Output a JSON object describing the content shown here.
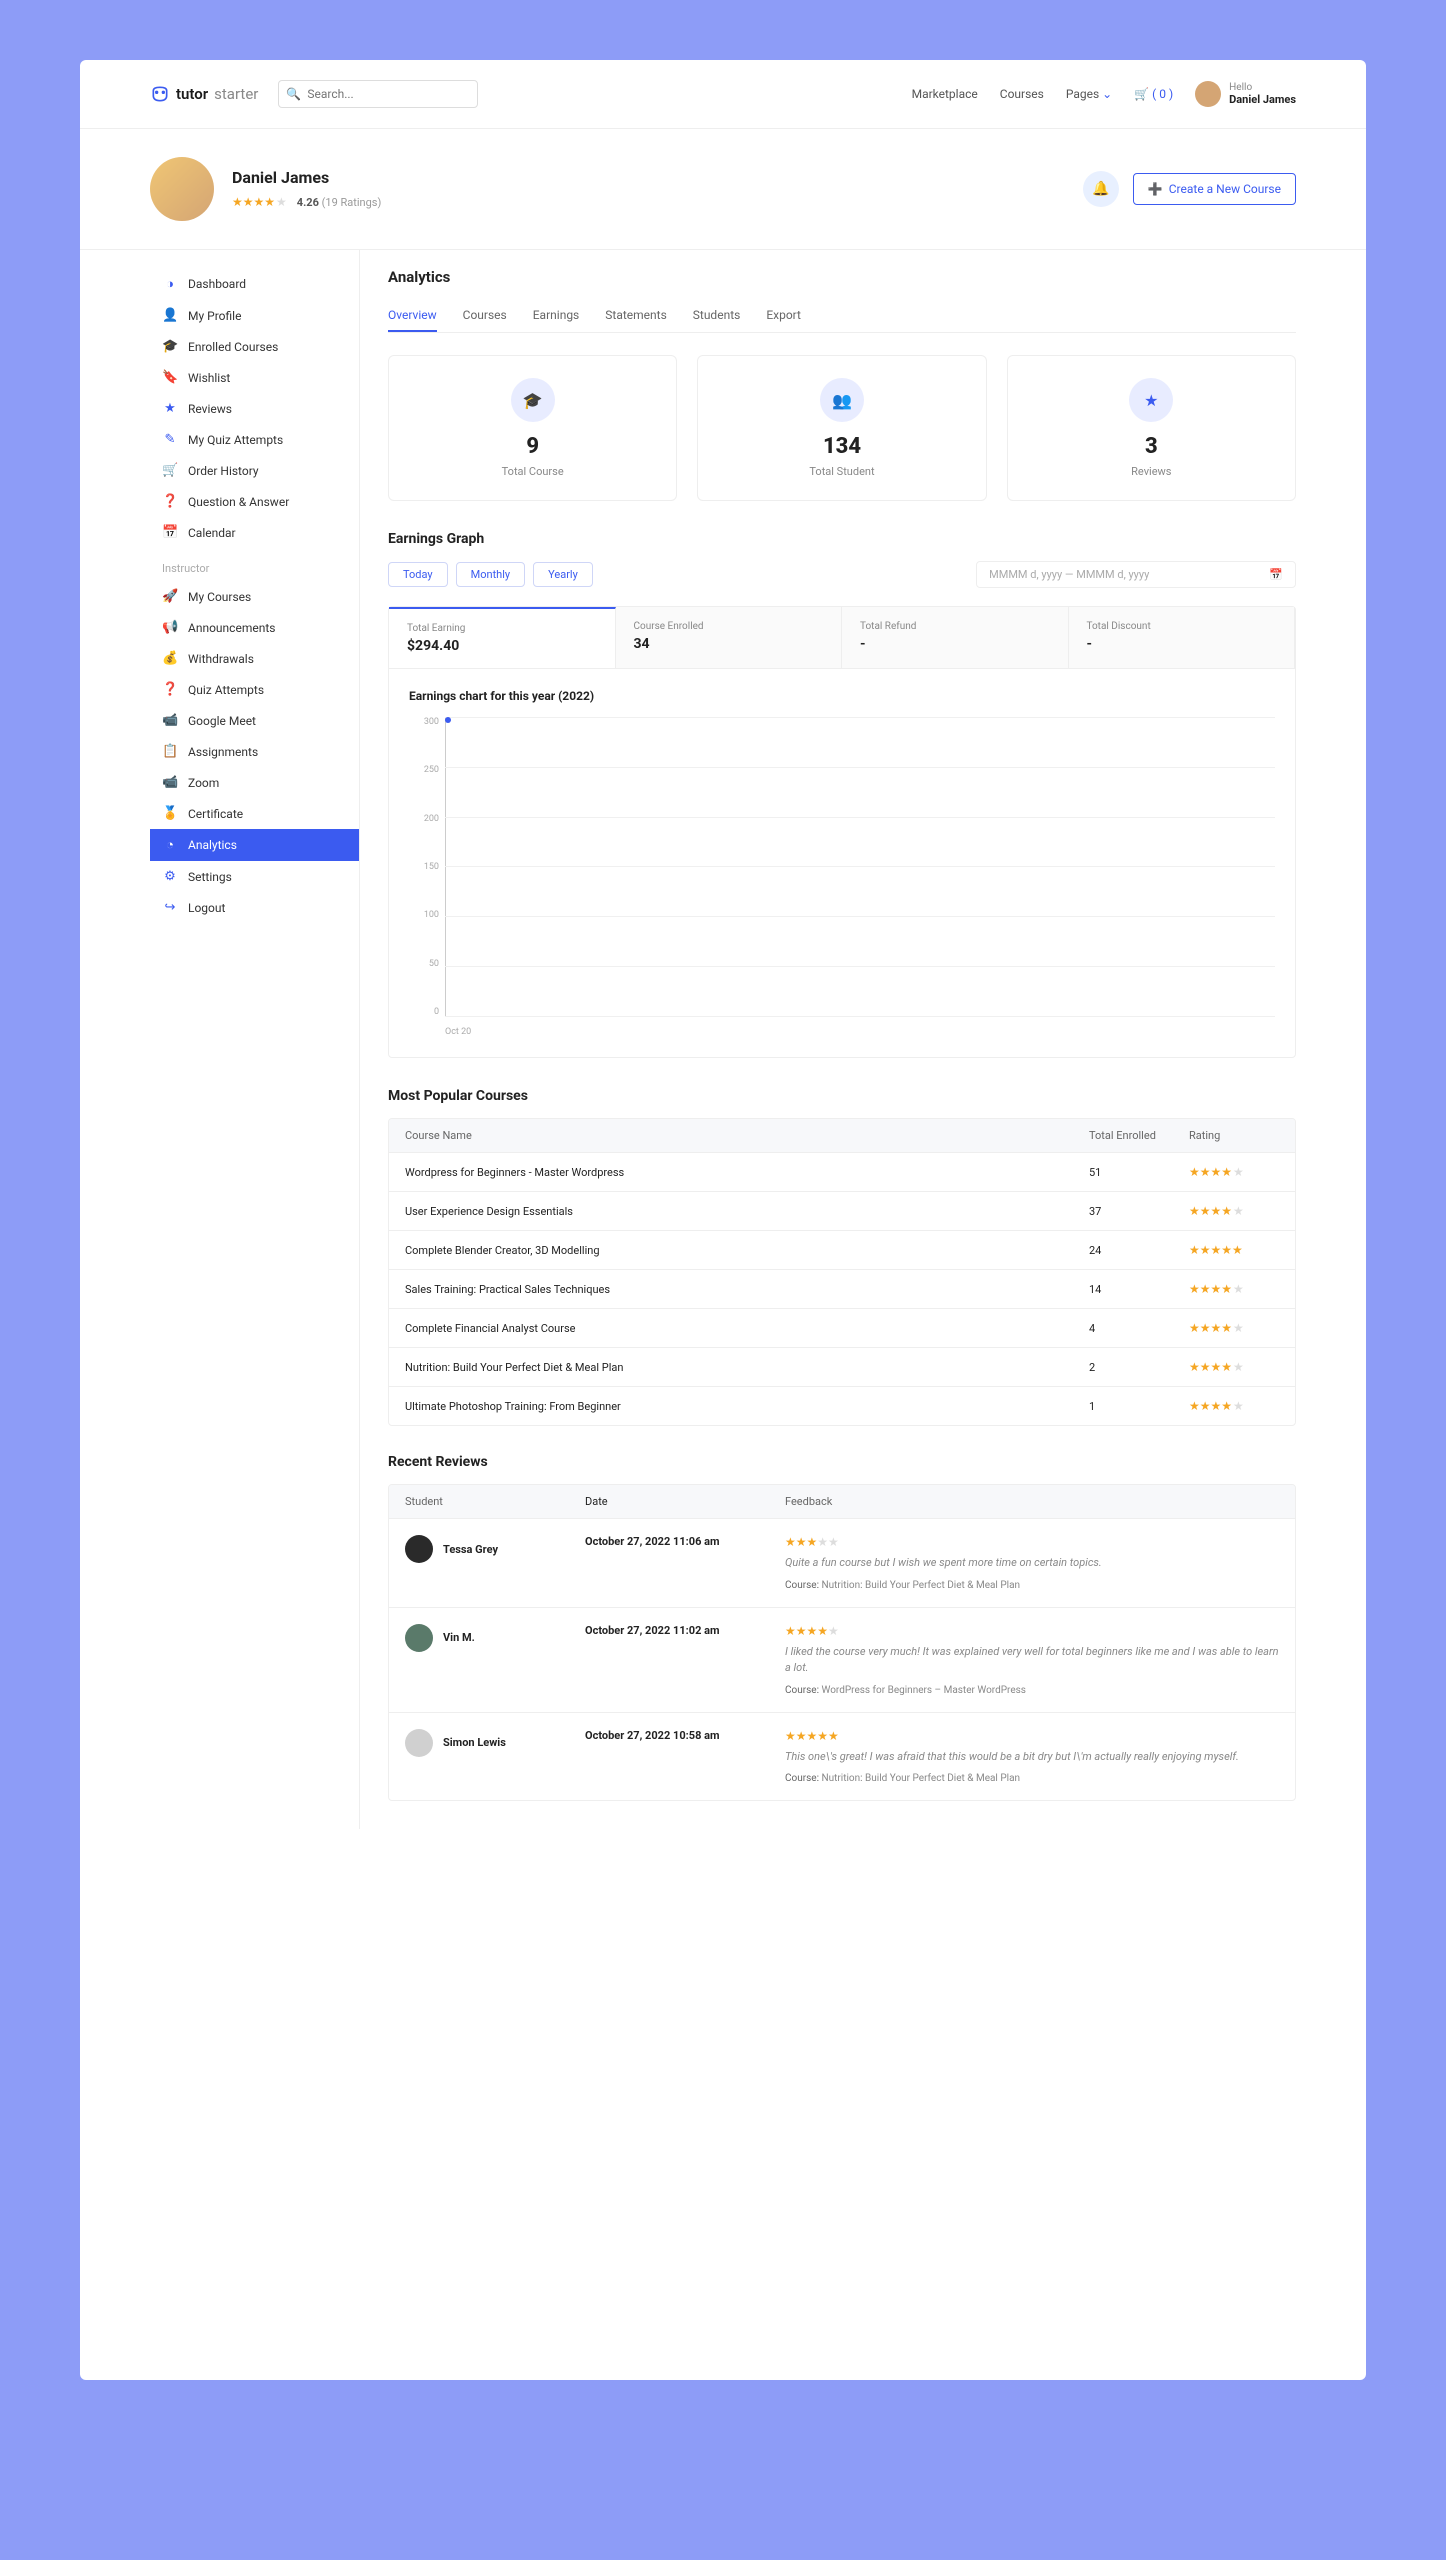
{
  "header": {
    "logo_a": "tutor",
    "logo_b": "starter",
    "search_placeholder": "Search...",
    "nav": {
      "marketplace": "Marketplace",
      "courses": "Courses",
      "pages": "Pages",
      "cart": "( 0 )",
      "hello": "Hello",
      "user": "Daniel James"
    }
  },
  "profile": {
    "name": "Daniel James",
    "rating": "4.26",
    "rating_count": "(19 Ratings)",
    "create_btn": "Create a New Course"
  },
  "sidebar": {
    "main": [
      {
        "icon": "◑",
        "label": "Dashboard"
      },
      {
        "icon": "👤",
        "label": "My Profile"
      },
      {
        "icon": "🎓",
        "label": "Enrolled Courses"
      },
      {
        "icon": "🔖",
        "label": "Wishlist"
      },
      {
        "icon": "★",
        "label": "Reviews"
      },
      {
        "icon": "✎",
        "label": "My Quiz Attempts"
      },
      {
        "icon": "🛒",
        "label": "Order History"
      },
      {
        "icon": "❓",
        "label": "Question & Answer"
      },
      {
        "icon": "📅",
        "label": "Calendar"
      }
    ],
    "sep": "Instructor",
    "instructor": [
      {
        "icon": "🚀",
        "label": "My Courses"
      },
      {
        "icon": "📢",
        "label": "Announcements"
      },
      {
        "icon": "💰",
        "label": "Withdrawals"
      },
      {
        "icon": "❓",
        "label": "Quiz Attempts"
      },
      {
        "icon": "📹",
        "label": "Google Meet"
      },
      {
        "icon": "📋",
        "label": "Assignments"
      },
      {
        "icon": "📹",
        "label": "Zoom"
      },
      {
        "icon": "🏅",
        "label": "Certificate"
      },
      {
        "icon": "◔",
        "label": "Analytics",
        "active": true
      }
    ],
    "bottom": [
      {
        "icon": "⚙",
        "label": "Settings"
      },
      {
        "icon": "↪",
        "label": "Logout"
      }
    ]
  },
  "page": {
    "title": "Analytics"
  },
  "tabs": [
    "Overview",
    "Courses",
    "Earnings",
    "Statements",
    "Students",
    "Export"
  ],
  "cards": [
    {
      "icon": "🎓",
      "value": "9",
      "label": "Total Course"
    },
    {
      "icon": "👥",
      "value": "134",
      "label": "Total Student"
    },
    {
      "icon": "★",
      "value": "3",
      "label": "Reviews"
    }
  ],
  "earnings": {
    "title": "Earnings Graph",
    "ranges": [
      "Today",
      "Monthly",
      "Yearly"
    ],
    "date_placeholder": "MMMM d, yyyy — MMMM d, yyyy",
    "gtabs": [
      {
        "label": "Total Earning",
        "value": "$294.40"
      },
      {
        "label": "Course Enrolled",
        "value": "34"
      },
      {
        "label": "Total Refund",
        "value": "-"
      },
      {
        "label": "Total Discount",
        "value": "-"
      }
    ],
    "chart_title": "Earnings chart for this year (2022)"
  },
  "chart_data": {
    "type": "line",
    "title": "Earnings chart for this year (2022)",
    "xlabel": "",
    "ylabel": "",
    "x": [
      "Oct 20"
    ],
    "values": [
      294.4
    ],
    "ylim": [
      0,
      300
    ],
    "yticks": [
      0,
      50,
      100,
      150,
      200,
      250,
      300
    ]
  },
  "popular": {
    "title": "Most Popular Courses",
    "headers": {
      "name": "Course Name",
      "enrolled": "Total Enrolled",
      "rating": "Rating"
    },
    "rows": [
      {
        "name": "Wordpress for Beginners - Master Wordpress",
        "enrolled": "51",
        "stars": 4
      },
      {
        "name": "User Experience Design Essentials",
        "enrolled": "37",
        "stars": 4
      },
      {
        "name": "Complete Blender Creator, 3D Modelling",
        "enrolled": "24",
        "stars": 5
      },
      {
        "name": "Sales Training: Practical Sales Techniques",
        "enrolled": "14",
        "stars": 4
      },
      {
        "name": "Complete Financial Analyst Course",
        "enrolled": "4",
        "stars": 4
      },
      {
        "name": "Nutrition: Build Your Perfect Diet & Meal Plan",
        "enrolled": "2",
        "stars": 4
      },
      {
        "name": "Ultimate Photoshop Training: From Beginner",
        "enrolled": "1",
        "stars": 4
      }
    ]
  },
  "reviews": {
    "title": "Recent Reviews",
    "headers": {
      "student": "Student",
      "date": "Date",
      "feedback": "Feedback"
    },
    "course_label": "Course:",
    "rows": [
      {
        "student": "Tessa Grey",
        "date": "October 27, 2022 11:06 am",
        "stars": 3,
        "text": "Quite a fun course but I wish we spent more time on certain topics.",
        "course": "Nutrition: Build Your Perfect Diet & Meal Plan",
        "color": "#2a2a2a"
      },
      {
        "student": "Vin M.",
        "date": "October 27, 2022 11:02 am",
        "stars": 4,
        "text": "I liked the course very much! It was explained very well for total beginners like me and I was able to learn a lot.",
        "course": "WordPress for Beginners – Master WordPress",
        "color": "#5a7a6a"
      },
      {
        "student": "Simon Lewis",
        "date": "October 27, 2022 10:58 am",
        "stars": 5,
        "text": "This one\\'s great! I was afraid that this would be a bit dry but I\\'m actually really enjoying myself.",
        "course": "Nutrition: Build Your Perfect Diet & Meal Plan",
        "color": "#d0d0d0"
      }
    ]
  }
}
